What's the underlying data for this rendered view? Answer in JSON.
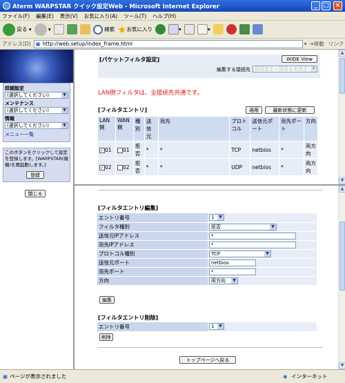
{
  "window": {
    "title": "Aterm WARPSTAR クイック設定Web - Microsoft Internet Explorer"
  },
  "menu": [
    "ファイル(F)",
    "編集(E)",
    "表示(V)",
    "お気に入り(A)",
    "ツール(T)",
    "ヘルプ(H)"
  ],
  "toolbar": {
    "back": "戻る",
    "search": "検索",
    "favorites": "お気に入り"
  },
  "address": {
    "label": "アドレス(D)",
    "url": "http://web.setup/index_frame.html",
    "go": "移動",
    "links": "リンク"
  },
  "left": {
    "detail_label": "詳細設定",
    "detail_select": "(選択してください)",
    "maint_label": "メンテナンス",
    "maint_select": "(選択してください)",
    "info_label": "情報",
    "info_select": "(選択してください)",
    "menu_link": "メニュー一覧",
    "note": "このボタンをクリックして設定を登録します。[WARPSTAR(親機)を再起動します。]",
    "register": "登録",
    "close": "閉じる"
  },
  "top": {
    "title": "[パケットフィルタ設定]",
    "wide_view": "WIDE View",
    "edit_target_label": "編集する接続先",
    "edit_target_value": "接続設定1(接続名未設定)",
    "notice": "LAN側フィルタは、全接続先共通です。",
    "entry_title": "[フィルタエントリ]",
    "apply": "適用",
    "refresh": "最新状態に更新",
    "headers": [
      "LAN側",
      "WAN側",
      "種別",
      "送信元",
      "宛先",
      "プロトコル",
      "送信元ポート",
      "宛先ポート",
      "方向"
    ],
    "rows": [
      {
        "lan": "01",
        "wan": "01",
        "type": "拒否",
        "src": "*",
        "dst": "*",
        "proto": "TCP",
        "sport": "netbios",
        "dport": "*",
        "dir": "両方向"
      },
      {
        "lan": "02",
        "wan": "02",
        "type": "拒否",
        "src": "*",
        "dst": "*",
        "proto": "UDP",
        "sport": "netbios",
        "dport": "*",
        "dir": "両方向"
      }
    ]
  },
  "edit": {
    "title": "[フィルタエントリ編集]",
    "fields": [
      {
        "label": "エントリ番号",
        "value": "1"
      },
      {
        "label": "フィルタ種別",
        "value": "拒否"
      },
      {
        "label": "送信元IPアドレス",
        "value": "*"
      },
      {
        "label": "宛先IPアドレス",
        "value": "*"
      },
      {
        "label": "プロトコル種別",
        "value": "TCP"
      },
      {
        "label": "送信元ポート",
        "value": "netbios"
      },
      {
        "label": "宛先ポート",
        "value": "*"
      },
      {
        "label": "方向",
        "value": "両方向"
      }
    ],
    "edit_button": "編集"
  },
  "delete": {
    "title": "[フィルタエントリ削除]",
    "label": "エントリ番号",
    "value": "1",
    "button": "削除"
  },
  "back_top": "トップページへ戻る",
  "status": {
    "text": "ページが表示されました",
    "zone": "インターネット"
  },
  "colors": {
    "title_bar": "#1747b8",
    "notice_red": "#e01010",
    "table_header": "#cfdcf0",
    "panel": "#d6dcf0"
  }
}
